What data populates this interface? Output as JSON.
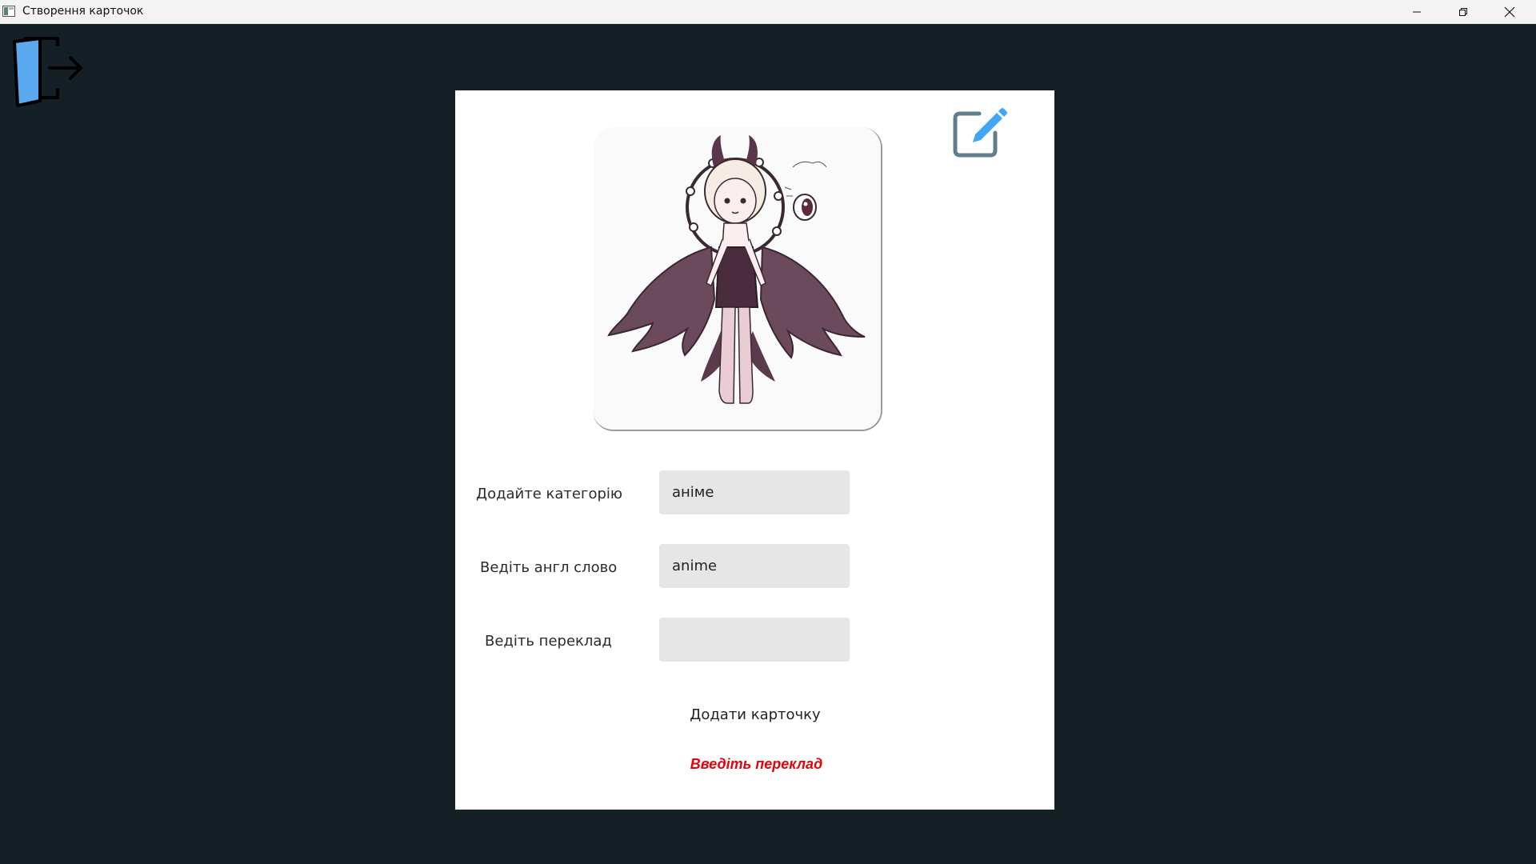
{
  "window": {
    "title": "Створення карточок",
    "controls": [
      "minimize",
      "restore",
      "close"
    ]
  },
  "toolbar": {
    "exit_icon": "exit-door-icon"
  },
  "card": {
    "edit_icon": "edit-pencil-icon",
    "image": {
      "icon": "anime-character-illustration"
    },
    "category": {
      "label": "Додайте категорію",
      "value": "аніме"
    },
    "english_word": {
      "label": "Ведіть англ слово",
      "value": "anime"
    },
    "translation": {
      "label": "Ведіть переклад",
      "value": ""
    },
    "add_button_label": "Додати карточку",
    "error_message": "Введіть переклад"
  },
  "colors": {
    "background": "#151f26",
    "card": "#ffffff",
    "field": "#e6e6e6",
    "error": "#e8000b",
    "exit_icon": "#5aa9ef",
    "edit_icon_frame": "#607d8b",
    "edit_icon_pencil": "#42a5f5"
  }
}
